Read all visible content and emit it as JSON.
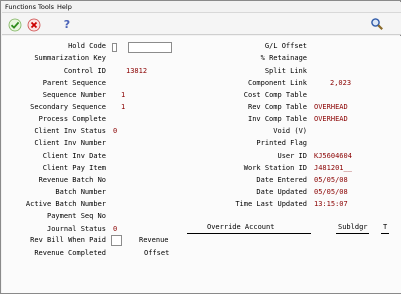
{
  "menu": {
    "functions": "Functions",
    "tools": "Tools",
    "help": "Help"
  },
  "toolbar": {
    "ok_icon": "checkmark-icon",
    "cancel_icon": "cancel-x-icon",
    "help_icon": "question-mark-icon",
    "search_icon": "binoculars-icon"
  },
  "left": {
    "hold_code": {
      "label": "Hold Code"
    },
    "summarization_key": {
      "label": "Summarization Key"
    },
    "control_id": {
      "label": "Control ID",
      "value": "13812"
    },
    "parent_sequence": {
      "label": "Parent Sequence"
    },
    "sequence_number": {
      "label": "Sequence Number",
      "value": "1"
    },
    "secondary_sequence": {
      "label": "Secondary Sequence",
      "value": "1"
    },
    "process_complete": {
      "label": "Process Complete"
    },
    "client_inv_status": {
      "label": "Client Inv Status",
      "value": "0"
    },
    "client_inv_number": {
      "label": "Client Inv Number"
    },
    "client_inv_date": {
      "label": "Client Inv Date"
    },
    "client_pay_item": {
      "label": "Client Pay Item"
    },
    "revenue_batch_no": {
      "label": "Revenue Batch No"
    },
    "batch_number": {
      "label": "Batch Number"
    },
    "active_batch_number": {
      "label": "Active Batch Number"
    },
    "payment_seq_no": {
      "label": "Payment Seq No"
    },
    "journal_status": {
      "label": "Journal Status",
      "value": "0"
    },
    "rev_bill_when_paid": {
      "label": "Rev Bill When Paid"
    },
    "revenue_completed": {
      "label": "Revenue Completed"
    }
  },
  "right": {
    "gl_offset": {
      "label": "G/L Offset"
    },
    "pct_retainage": {
      "label": "% Retainage"
    },
    "split_link": {
      "label": "Split Link"
    },
    "component_link": {
      "label": "Component Link",
      "value": "2,023"
    },
    "cost_comp_table": {
      "label": "Cost Comp Table"
    },
    "rev_comp_table": {
      "label": "Rev Comp Table",
      "value": "OVERHEAD"
    },
    "inv_comp_table": {
      "label": "Inv Comp Table",
      "value": "OVERHEAD"
    },
    "void": {
      "label": "Void (V)"
    },
    "printed_flag": {
      "label": "Printed Flag"
    },
    "user_id": {
      "label": "User ID",
      "value": "KJ5604604"
    },
    "work_station_id": {
      "label": "Work Station ID",
      "value": "J481201__"
    },
    "date_entered": {
      "label": "Date Entered",
      "value": "05/05/08"
    },
    "date_updated": {
      "label": "Date Updated",
      "value": "05/05/08"
    },
    "time_last_updated": {
      "label": "Time Last Updated",
      "value": "13:15:07"
    }
  },
  "override": {
    "revenue_label": "Revenue",
    "offset_label": "Offset",
    "override_account_header": "Override Account",
    "subledger_header": "Subldgr",
    "type_header": "T"
  }
}
